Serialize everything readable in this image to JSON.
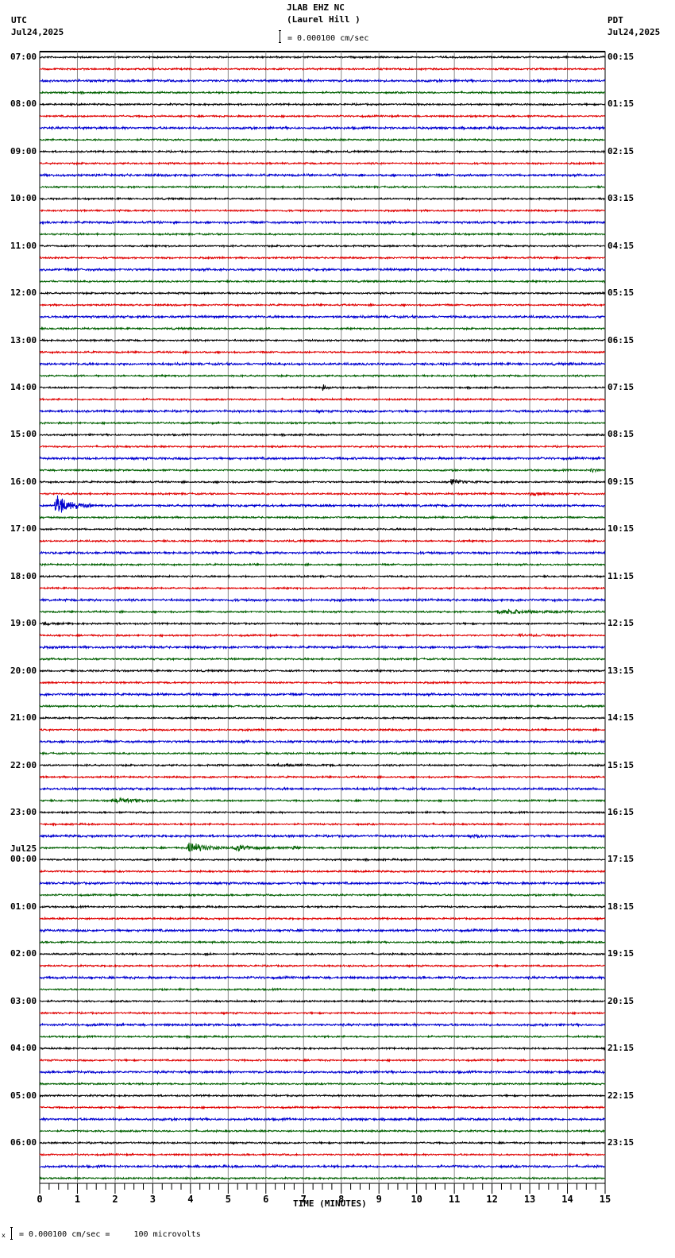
{
  "header": {
    "station": "JLAB EHZ NC",
    "location": "(Laurel Hill )",
    "scale_text": "= 0.000100 cm/sec",
    "left_tz": "UTC",
    "left_date": "Jul24,2025",
    "right_tz": "PDT",
    "right_date": "Jul24,2025"
  },
  "footer": {
    "scale_text": "= 0.000100 cm/sec =     100 microvolts",
    "mark": "x"
  },
  "chart_data": {
    "type": "line",
    "title": "JLAB EHZ NC (Laurel Hill )",
    "xlabel": "TIME (MINUTES)",
    "xlim": [
      0,
      15
    ],
    "x_ticks": [
      "0",
      "1",
      "2",
      "3",
      "4",
      "5",
      "6",
      "7",
      "8",
      "9",
      "10",
      "11",
      "12",
      "13",
      "14",
      "15"
    ],
    "traces_per_hour": 4,
    "trace_count": 96,
    "trace_colors": [
      "#000000",
      "#e00000",
      "#0000d0",
      "#006000"
    ],
    "left_labels": [
      "07:00",
      "08:00",
      "09:00",
      "10:00",
      "11:00",
      "12:00",
      "13:00",
      "14:00",
      "15:00",
      "16:00",
      "17:00",
      "18:00",
      "19:00",
      "20:00",
      "21:00",
      "22:00",
      "23:00",
      "00:00",
      "01:00",
      "02:00",
      "03:00",
      "04:00",
      "05:00",
      "06:00"
    ],
    "date_change_label": "Jul25",
    "right_labels": [
      "00:15",
      "01:15",
      "02:15",
      "03:15",
      "04:15",
      "05:15",
      "06:15",
      "07:15",
      "08:15",
      "09:15",
      "10:15",
      "11:15",
      "12:15",
      "13:15",
      "14:15",
      "15:15",
      "16:15",
      "17:15",
      "18:15",
      "19:15",
      "20:15",
      "21:15",
      "22:15",
      "23:15"
    ],
    "events": [
      {
        "trace": 8,
        "minute": 7.6,
        "amplitude": 3,
        "duration": 0.5
      },
      {
        "trace": 28,
        "minute": 7.5,
        "amplitude": 14,
        "duration": 0.2
      },
      {
        "trace": 35,
        "minute": 14.6,
        "amplitude": 8,
        "duration": 0.4
      },
      {
        "trace": 36,
        "minute": 10.9,
        "amplitude": 11,
        "duration": 0.8
      },
      {
        "trace": 37,
        "minute": 13.0,
        "amplitude": 3,
        "duration": 2.0
      },
      {
        "trace": 38,
        "minute": 0.4,
        "amplitude": 40,
        "duration": 1.0
      },
      {
        "trace": 47,
        "minute": 12.1,
        "amplitude": 7,
        "duration": 2.9
      },
      {
        "trace": 48,
        "minute": 0.1,
        "amplitude": 4,
        "duration": 0.7
      },
      {
        "trace": 49,
        "minute": 12.7,
        "amplitude": 3,
        "duration": 1.8
      },
      {
        "trace": 60,
        "minute": 6.2,
        "amplitude": 3,
        "duration": 1.6
      },
      {
        "trace": 63,
        "minute": 1.9,
        "amplitude": 6,
        "duration": 2.5
      },
      {
        "trace": 66,
        "minute": 11.5,
        "amplitude": 8,
        "duration": 0.5
      },
      {
        "trace": 67,
        "minute": 3.9,
        "amplitude": 20,
        "duration": 1.2
      },
      {
        "trace": 67,
        "minute": 5.1,
        "amplitude": 10,
        "duration": 1.5
      },
      {
        "trace": 67,
        "minute": 6.7,
        "amplitude": 6,
        "duration": 0.4
      },
      {
        "trace": 76,
        "minute": 4.4,
        "amplitude": 7,
        "duration": 0.15
      }
    ]
  }
}
